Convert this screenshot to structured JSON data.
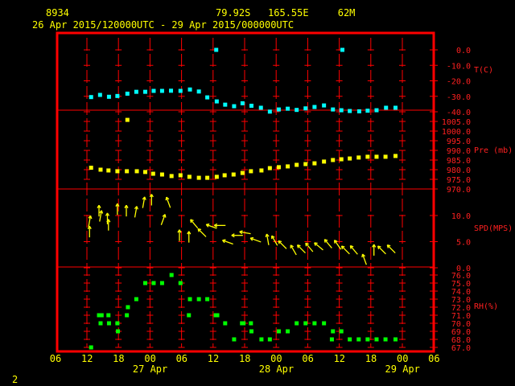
{
  "header": {
    "station": "8934",
    "location": "79.92S   165.55E     62M",
    "time_range": "26 Apr 2015/120000UTC - 29 Apr 2015/000000UTC"
  },
  "footer": {
    "page_number": "2"
  },
  "colors": {
    "frame": "#ff0000",
    "temperature": "#00ffff",
    "pressure": "#ffff00",
    "wind": "#ffff00",
    "humidity": "#00ff00",
    "text": "#ffff00"
  },
  "chart_data": [
    {
      "type": "scatter",
      "name": "temperature",
      "ylabel": "T(C)",
      "ylim": [
        -40,
        0
      ],
      "yticks": [
        "0.0",
        "-10.0",
        "-20.0",
        "-30.0",
        "-40.0"
      ],
      "x_units": "hours after 26 Apr 2015 12UTC",
      "points": [
        [
          0.8,
          -30.5
        ],
        [
          2.5,
          -29.1
        ],
        [
          4.2,
          -30.3
        ],
        [
          5.8,
          -29.8
        ],
        [
          7.7,
          -28.3
        ],
        [
          9.4,
          -27.1
        ],
        [
          11.1,
          -27.1
        ],
        [
          12.7,
          -26.5
        ],
        [
          14.3,
          -26.5
        ],
        [
          16,
          -26.4
        ],
        [
          17.8,
          -26.5
        ],
        [
          19.6,
          -25.6
        ],
        [
          21.3,
          -26.9
        ],
        [
          22.9,
          -30.7
        ],
        [
          24.7,
          -33.3
        ],
        [
          26.3,
          -35.4
        ],
        [
          28,
          -36.4
        ],
        [
          29.6,
          -34.5
        ],
        [
          31.3,
          -36.1
        ],
        [
          33.1,
          -37.4
        ],
        [
          34.8,
          -39.9
        ],
        [
          36.5,
          -38.5
        ],
        [
          38.2,
          -38
        ],
        [
          39.9,
          -38.8
        ],
        [
          41.6,
          -37.8
        ],
        [
          43.3,
          -36.9
        ],
        [
          45.1,
          -35.9
        ],
        [
          46.8,
          -38.5
        ],
        [
          48.4,
          -39
        ],
        [
          50,
          -39.5
        ],
        [
          51.8,
          -39.7
        ],
        [
          53.4,
          -39.3
        ],
        [
          55.1,
          -39
        ],
        [
          56.9,
          -37.4
        ],
        [
          58.7,
          -37.4
        ],
        [
          24.6,
          0.0
        ],
        [
          48.6,
          0.0
        ]
      ]
    },
    {
      "type": "scatter",
      "name": "pressure",
      "ylabel": "Pre (mb)",
      "ylim": [
        970,
        1005
      ],
      "yticks": [
        "1005.0",
        "1000.0",
        "995.0",
        "990.0",
        "985.0",
        "980.0",
        "975.0",
        "970.0"
      ],
      "points": [
        [
          0.8,
          981
        ],
        [
          2.6,
          980
        ],
        [
          4.1,
          979.6
        ],
        [
          5.8,
          979.2
        ],
        [
          7.6,
          979.2
        ],
        [
          9.5,
          979.2
        ],
        [
          11.1,
          978.8
        ],
        [
          12.6,
          977.9
        ],
        [
          14.3,
          977.5
        ],
        [
          16.1,
          976.7
        ],
        [
          17.8,
          977.1
        ],
        [
          19.5,
          976.3
        ],
        [
          21.3,
          975.8
        ],
        [
          22.9,
          975.8
        ],
        [
          24.7,
          976.3
        ],
        [
          26.2,
          977.1
        ],
        [
          27.9,
          977.5
        ],
        [
          29.6,
          978.3
        ],
        [
          31.2,
          979.2
        ],
        [
          33.2,
          979.6
        ],
        [
          34.8,
          980.8
        ],
        [
          36.5,
          981.3
        ],
        [
          38.2,
          981.7
        ],
        [
          39.9,
          982.5
        ],
        [
          41.6,
          982.9
        ],
        [
          43.3,
          983.3
        ],
        [
          45.1,
          984.2
        ],
        [
          46.8,
          985
        ],
        [
          48.4,
          985.4
        ],
        [
          50,
          985.8
        ],
        [
          51.7,
          986.3
        ],
        [
          53.4,
          986.7
        ],
        [
          55.1,
          986.7
        ],
        [
          56.8,
          986.7
        ],
        [
          58.7,
          987.1
        ],
        [
          7.7,
          1005.8
        ]
      ]
    },
    {
      "type": "scatter",
      "name": "wind",
      "ylabel": "SPD(MPS)",
      "ylim": [
        0,
        15
      ],
      "yticks": [
        "10.0",
        "5.0",
        "0.0"
      ],
      "point_format": "[hour, speed_mps, arrow_bearing_deg]",
      "points": [
        [
          0.5,
          6.9,
          0
        ],
        [
          0.5,
          8.9,
          10
        ],
        [
          2.3,
          10.9,
          0
        ],
        [
          2.6,
          9.9,
          10
        ],
        [
          3.9,
          9.4,
          0
        ],
        [
          4.1,
          8.2,
          0
        ],
        [
          5.8,
          11.2,
          0
        ],
        [
          7.5,
          10.9,
          0
        ],
        [
          9.3,
          10.7,
          10
        ],
        [
          10.8,
          12.5,
          10
        ],
        [
          12.3,
          13,
          0
        ],
        [
          14.5,
          9.2,
          20
        ],
        [
          15.5,
          12.5,
          340
        ],
        [
          17.6,
          6.2,
          0
        ],
        [
          19.4,
          5.9,
          0
        ],
        [
          20.4,
          8.4,
          320
        ],
        [
          21.9,
          6.7,
          315
        ],
        [
          23.7,
          7.9,
          290
        ],
        [
          25.3,
          8.1,
          270
        ],
        [
          26.8,
          4.9,
          290
        ],
        [
          28.6,
          6.2,
          270
        ],
        [
          30.1,
          6.7,
          280
        ],
        [
          32.1,
          5.3,
          290
        ],
        [
          34.4,
          5.4,
          350
        ],
        [
          35.7,
          5.2,
          330
        ],
        [
          37.2,
          4.4,
          315
        ],
        [
          39.3,
          3.4,
          330
        ],
        [
          40.8,
          3.6,
          315
        ],
        [
          42.3,
          3.9,
          320
        ],
        [
          44.1,
          4.1,
          310
        ],
        [
          45.9,
          4.6,
          320
        ],
        [
          47.7,
          4.4,
          325
        ],
        [
          49.2,
          3.4,
          315
        ],
        [
          50.8,
          3.4,
          320
        ],
        [
          52.8,
          1.6,
          340
        ],
        [
          54.6,
          3.4,
          0
        ],
        [
          56.1,
          3.4,
          315
        ],
        [
          57.9,
          3.6,
          315
        ]
      ]
    },
    {
      "type": "scatter",
      "name": "humidity",
      "ylabel": "RH(%)",
      "ylim": [
        67,
        76
      ],
      "yticks": [
        "76.0",
        "75.0",
        "74.0",
        "73.0",
        "72.0",
        "71.0",
        "70.0",
        "69.0",
        "68.0",
        "67.0"
      ],
      "points": [
        [
          0.8,
          67
        ],
        [
          2.3,
          71
        ],
        [
          2.8,
          71
        ],
        [
          2.6,
          70
        ],
        [
          4.1,
          71
        ],
        [
          4.2,
          70
        ],
        [
          5.8,
          70
        ],
        [
          5.9,
          69
        ],
        [
          7.6,
          71
        ],
        [
          7.8,
          72
        ],
        [
          9.4,
          73
        ],
        [
          11.1,
          75
        ],
        [
          12.7,
          75
        ],
        [
          14.3,
          75
        ],
        [
          16.1,
          76
        ],
        [
          17.8,
          75
        ],
        [
          19.4,
          71
        ],
        [
          19.6,
          73
        ],
        [
          21.3,
          73
        ],
        [
          22.9,
          73
        ],
        [
          24.5,
          71
        ],
        [
          24.8,
          71
        ],
        [
          26.3,
          70
        ],
        [
          28,
          68
        ],
        [
          29.5,
          70
        ],
        [
          29.8,
          70
        ],
        [
          31.2,
          70
        ],
        [
          31.3,
          69
        ],
        [
          33.2,
          68
        ],
        [
          34.8,
          68
        ],
        [
          36.5,
          69
        ],
        [
          38.2,
          69
        ],
        [
          39.9,
          70
        ],
        [
          41.6,
          70
        ],
        [
          43.3,
          70
        ],
        [
          45.1,
          70
        ],
        [
          46.6,
          68
        ],
        [
          46.8,
          69
        ],
        [
          48.4,
          69
        ],
        [
          50,
          68
        ],
        [
          51.7,
          68
        ],
        [
          53.4,
          68
        ],
        [
          55.1,
          68
        ],
        [
          56.8,
          68
        ],
        [
          58.7,
          68
        ]
      ]
    }
  ],
  "x_axis": {
    "tick_labels": [
      "06",
      "12",
      "18",
      "00",
      "06",
      "12",
      "18",
      "00",
      "06",
      "12",
      "18",
      "00",
      "06"
    ],
    "date_labels": [
      {
        "label": "27 Apr",
        "tick": 3
      },
      {
        "label": "28 Apr",
        "tick": 7
      },
      {
        "label": "29 Apr",
        "tick": 11
      }
    ]
  }
}
